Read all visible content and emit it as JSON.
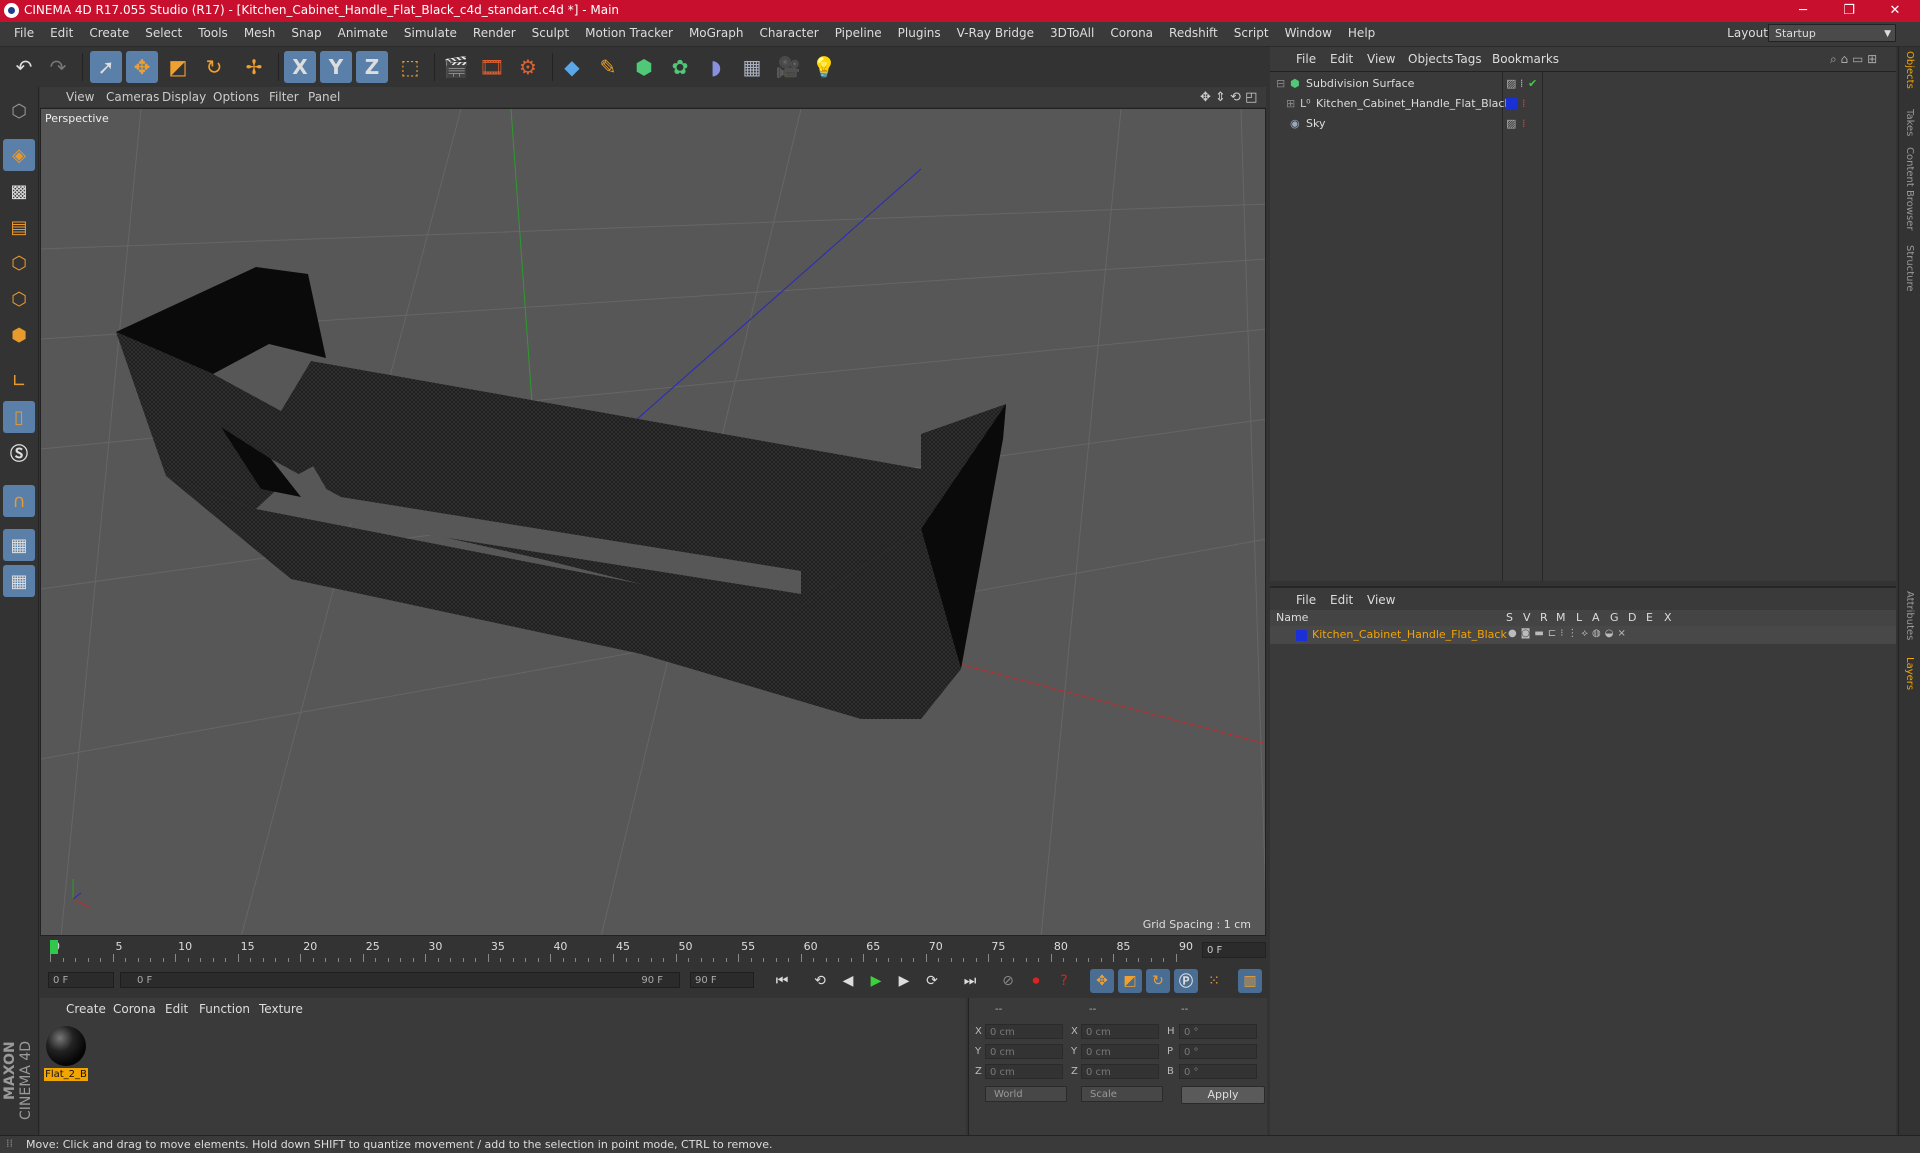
{
  "window": {
    "title": "CINEMA 4D R17.055 Studio (R17) - [Kitchen_Cabinet_Handle_Flat_Black_c4d_standart.c4d *] - Main",
    "minimize": "─",
    "maximize": "❐",
    "close": "✕"
  },
  "menubar": {
    "items": [
      "File",
      "Edit",
      "Create",
      "Select",
      "Tools",
      "Mesh",
      "Snap",
      "Animate",
      "Simulate",
      "Render",
      "Sculpt",
      "Motion Tracker",
      "MoGraph",
      "Character",
      "Pipeline",
      "Plugins",
      "V-Ray Bridge",
      "3DToAll",
      "Corona",
      "Redshift",
      "Script",
      "Window",
      "Help"
    ],
    "layout_label": "Layout:",
    "layout_value": "Startup"
  },
  "toolbar": {
    "icons": [
      "undo-icon",
      "redo-icon",
      "select-arrow-icon",
      "move-icon",
      "scale-icon",
      "rotate-icon",
      "move-multi-icon",
      "x-axis-icon",
      "y-axis-icon",
      "z-axis-icon",
      "world-coords-icon",
      "render-view-icon",
      "render-picture-viewer-icon",
      "render-settings-icon",
      "cube-icon",
      "pen-spline-icon",
      "subdivision-icon",
      "cloner-icon",
      "deformer-icon",
      "floor-icon",
      "camera-icon",
      "light-icon"
    ],
    "axis_labels": [
      "X",
      "Y",
      "Z"
    ]
  },
  "viewport": {
    "menu": [
      "View",
      "Cameras",
      "Display",
      "Options",
      "Filter",
      "Panel"
    ],
    "label": "Perspective",
    "grid_spacing": "Grid Spacing : 1 cm"
  },
  "timeline": {
    "marks": [
      "0",
      "5",
      "10",
      "15",
      "20",
      "25",
      "30",
      "35",
      "40",
      "45",
      "50",
      "55",
      "60",
      "65",
      "70",
      "75",
      "80",
      "85",
      "90"
    ],
    "current_frame": "0 F",
    "start_field": "0 F",
    "slider_left": "0 F",
    "slider_right": "90 F",
    "end_field": "90 F"
  },
  "material_manager": {
    "menu": [
      "Create",
      "Corona",
      "Edit",
      "Function",
      "Texture"
    ],
    "material_name": "Flat_2_B"
  },
  "coordinates": {
    "headers": [
      "--",
      "--",
      "--"
    ],
    "rows": [
      {
        "l1": "X",
        "v1": "0 cm",
        "l2": "X",
        "v2": "0 cm",
        "l3": "H",
        "v3": "0 °"
      },
      {
        "l1": "Y",
        "v1": "0 cm",
        "l2": "Y",
        "v2": "0 cm",
        "l3": "P",
        "v3": "0 °"
      },
      {
        "l1": "Z",
        "v1": "0 cm",
        "l2": "Z",
        "v2": "0 cm",
        "l3": "B",
        "v3": "0 °"
      }
    ],
    "mode_world": "World",
    "mode_scale": "Scale",
    "apply": "Apply"
  },
  "object_manager": {
    "menu": [
      "File",
      "Edit",
      "View",
      "Objects",
      "Tags",
      "Bookmarks"
    ],
    "objects": [
      {
        "name": "Subdivision Surface",
        "icon": "subdivision-icon"
      },
      {
        "name": "Kitchen_Cabinet_Handle_Flat_Black",
        "icon": "null-object-icon",
        "color": "#1a2fd6"
      },
      {
        "name": "Sky",
        "icon": "sky-icon"
      }
    ]
  },
  "layer_manager": {
    "menu": [
      "File",
      "Edit",
      "View"
    ],
    "columns": [
      "Name",
      "S",
      "V",
      "R",
      "M",
      "L",
      "A",
      "G",
      "D",
      "E",
      "X"
    ],
    "layer_name": "Kitchen_Cabinet_Handle_Flat_Black",
    "layer_color": "#1a2fd6"
  },
  "right_tabs": [
    "Objects",
    "Takes",
    "Content Browser",
    "Structure",
    "Attributes",
    "Layers"
  ],
  "status": "Move: Click and drag to move elements. Hold down SHIFT to quantize movement / add to the selection in point mode, CTRL to remove.",
  "logo": {
    "line1": "MAXON",
    "line2": "CINEMA 4D"
  },
  "colors": {
    "title_bar": "#c8102e",
    "accent_orange": "#f2a400",
    "selected_tool": "#5a7fa8"
  }
}
